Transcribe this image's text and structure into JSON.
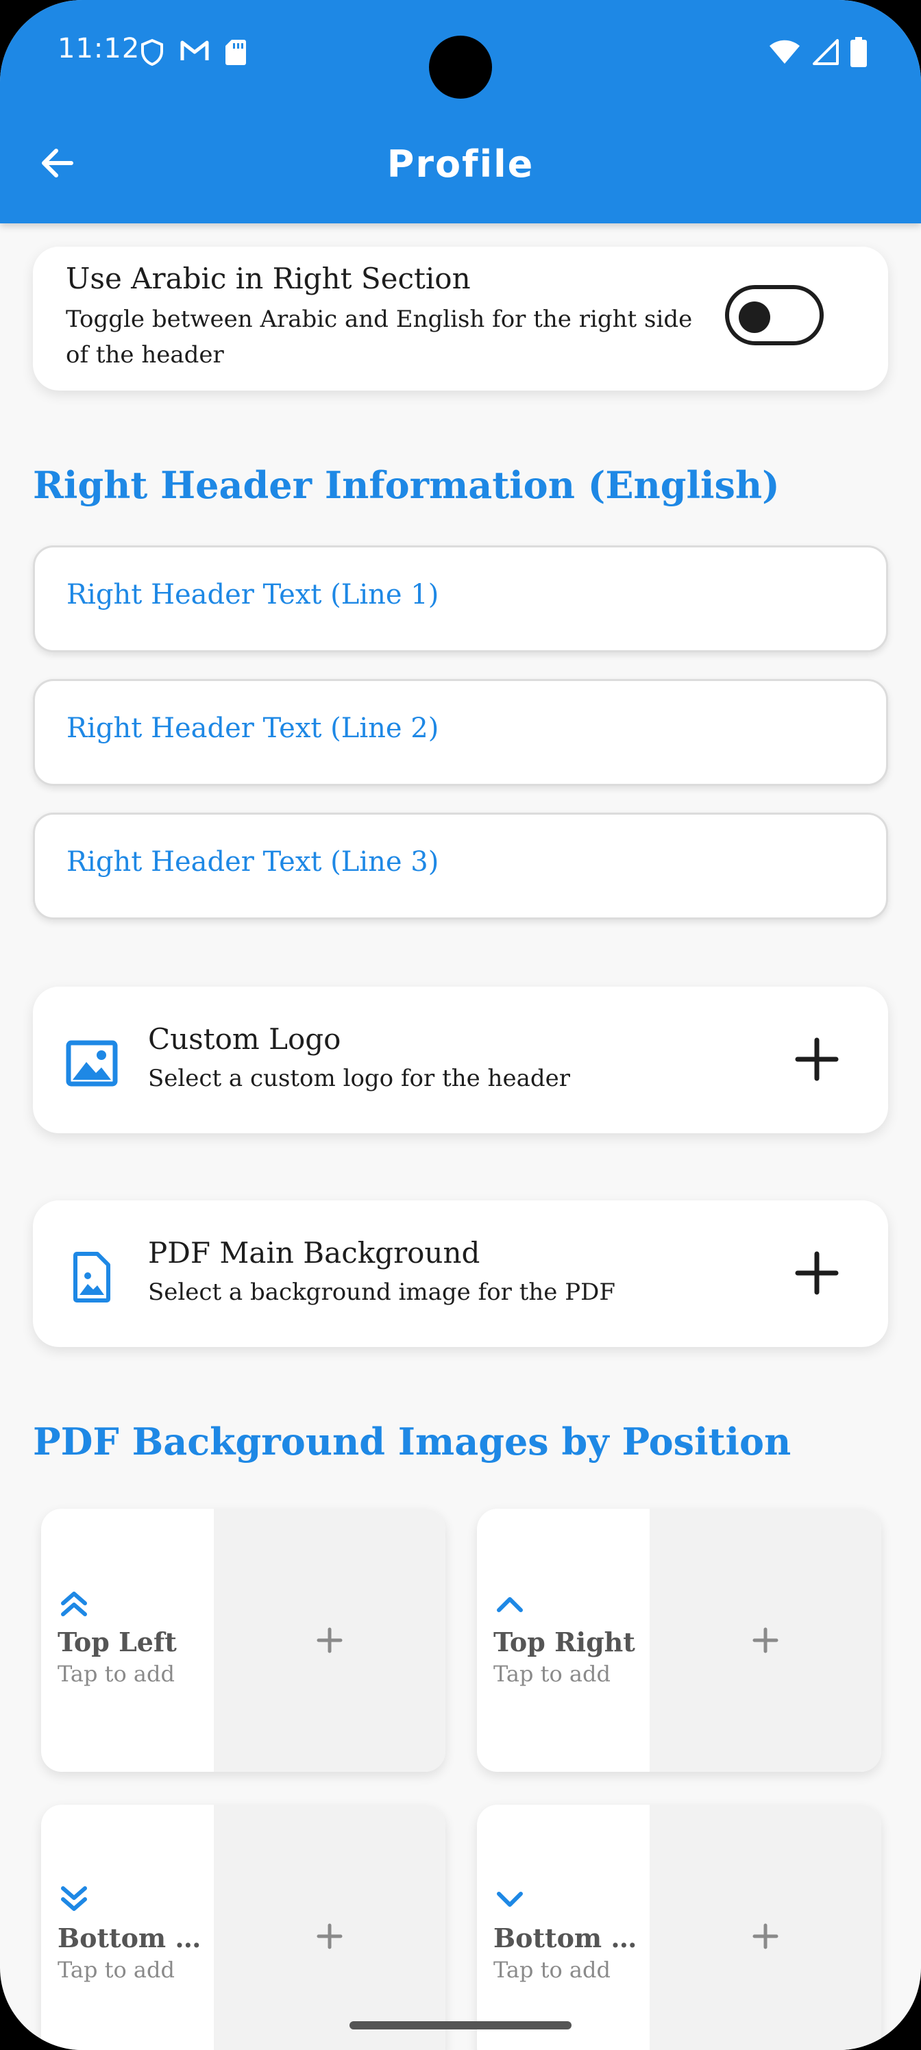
{
  "status_bar": {
    "time": "11:12",
    "left_icons": [
      "shield-icon",
      "gmail-icon",
      "sd-card-icon"
    ],
    "right_icons": [
      "wifi-icon",
      "signal-icon",
      "battery-icon"
    ]
  },
  "app_bar": {
    "title": "Profile",
    "back_icon": "arrow-back-icon",
    "color": "#1e88e5"
  },
  "arabic_toggle": {
    "title": "Use Arabic in Right Section",
    "subtitle": "Toggle between Arabic and English for the right side of the header",
    "enabled": false
  },
  "right_header_section": {
    "title": "Right Header Information (English)",
    "fields": [
      {
        "placeholder": "Right Header Text (Line 1)",
        "value": ""
      },
      {
        "placeholder": "Right Header Text (Line 2)",
        "value": ""
      },
      {
        "placeholder": "Right Header Text (Line 3)",
        "value": ""
      }
    ]
  },
  "custom_logo": {
    "title": "Custom Logo",
    "subtitle": "Select a custom logo for the header",
    "icon": "image-icon"
  },
  "pdf_background": {
    "title": "PDF Main Background",
    "subtitle": "Select a background image for the PDF",
    "icon": "image-file-icon"
  },
  "position_section": {
    "title": "PDF Background Images by Position",
    "positions": [
      {
        "label": "Top Left",
        "sub": "Tap to add",
        "icon": "double-chevron-up-icon"
      },
      {
        "label": "Top Right",
        "sub": "Tap to add",
        "icon": "chevron-up-icon"
      },
      {
        "label": "Bottom L...",
        "sub": "Tap to add",
        "icon": "double-chevron-down-icon"
      },
      {
        "label": "Bottom R...",
        "sub": "Tap to add",
        "icon": "chevron-down-icon"
      }
    ]
  }
}
